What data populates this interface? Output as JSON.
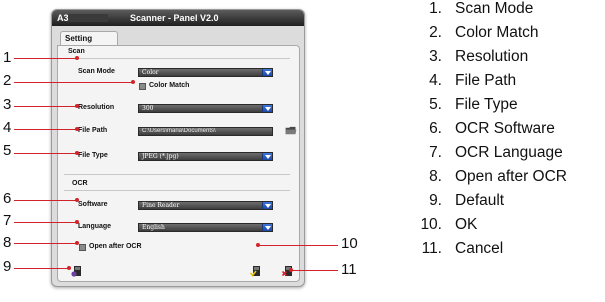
{
  "window": {
    "model": "A3",
    "title": "Scanner - Panel V2.0",
    "tab": "Setting"
  },
  "scan": {
    "section": "Scan",
    "scan_mode_label": "Scan Mode",
    "scan_mode_value": "Color",
    "color_match_label": "Color Match",
    "resolution_label": "Resolution",
    "resolution_value": "300",
    "file_path_label": "File Path",
    "file_path_value": "C:\\Users\\maria\\Documents\\",
    "file_type_label": "File Type",
    "file_type_value": "JPEG (*.jpg)"
  },
  "ocr": {
    "section": "OCR",
    "software_label": "Software",
    "software_value": "Fine Reader",
    "language_label": "Language",
    "language_value": "English",
    "open_after_label": "Open after OCR"
  },
  "callouts": {
    "c1": "1",
    "c2": "2",
    "c3": "3",
    "c4": "4",
    "c5": "5",
    "c6": "6",
    "c7": "7",
    "c8": "8",
    "c9": "9",
    "c10": "10",
    "c11": "11"
  },
  "legend": [
    {
      "num": "1.",
      "label": "Scan Mode"
    },
    {
      "num": "2.",
      "label": "Color Match"
    },
    {
      "num": "3.",
      "label": "Resolution"
    },
    {
      "num": "4.",
      "label": "File Path"
    },
    {
      "num": "5.",
      "label": "File Type"
    },
    {
      "num": "6.",
      "label": "OCR Software"
    },
    {
      "num": "7.",
      "label": "OCR Language"
    },
    {
      "num": "8.",
      "label": "Open after OCR"
    },
    {
      "num": "9.",
      "label": "Default"
    },
    {
      "num": "10.",
      "label": "OK"
    },
    {
      "num": "11.",
      "label": "Cancel"
    }
  ],
  "icons": {
    "default": "reset-icon",
    "ok": "ok-icon",
    "cancel": "cancel-icon",
    "browse": "folder-icon"
  },
  "colors": {
    "callout_line": "#d2232a",
    "dropdown_button": "#2a5cc4",
    "title_bar": "#2a2a2a"
  }
}
